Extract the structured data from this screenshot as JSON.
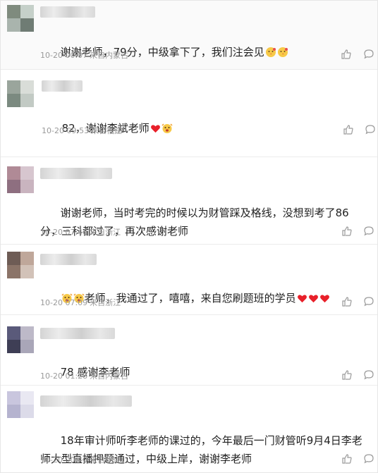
{
  "comments": [
    {
      "text": "谢谢老师，79分，中级拿下了，我们注会见",
      "time": "10-20 00:07",
      "location": "来自内蒙古",
      "trailing_emojis": [
        "kiss-face",
        "kiss-face"
      ],
      "avatar_colors": [
        "#7f8b7e",
        "#c5d0c9",
        "#a9b4ad",
        "#6f7c74"
      ]
    },
    {
      "text": "82，谢谢李斌老师",
      "time": "10-20 09:53",
      "location": "来自福建",
      "trailing_emojis": [
        "red-heart",
        "cheering-face"
      ],
      "avatar_colors": [
        "#9aa59c",
        "#d9ddd8",
        "#7b8a80",
        "#c2cac4"
      ]
    },
    {
      "text": "谢谢老师，当时考完的时候以为财管踩及格线，没想到考了86分，三科都过了，再次感谢老师",
      "time": "10-20 07:46",
      "location": "来自浙江",
      "trailing_emojis": [],
      "avatar_colors": [
        "#b08a96",
        "#d7c6cf",
        "#8e6f80",
        "#c9b4bf"
      ]
    },
    {
      "text": "老师，我通过了，嘻嘻，来自您刷题班的学员",
      "time": "10-20 07:09",
      "location": "来自浙江",
      "leading_emojis": [
        "cheering-face",
        "cheering-face"
      ],
      "trailing_emojis": [
        "red-heart",
        "red-heart",
        "red-heart"
      ],
      "avatar_colors": [
        "#6e5c55",
        "#bfa79a",
        "#8b7468",
        "#d2c2b8"
      ]
    },
    {
      "text": "78 感谢李老师",
      "time": "10-20 01:28",
      "location": "来自内蒙古",
      "trailing_emojis": [],
      "avatar_colors": [
        "#5a5a7a",
        "#bdb9c8",
        "#3e3e55",
        "#a9a6b8"
      ]
    },
    {
      "text": "18年审计师听李老师的课过的，今年最后一门财管听9月4日李老师大型直播押题通过，中级上岸，谢谢李老师",
      "time": "10-20 00:40",
      "location": "来自北京",
      "trailing_emojis": [],
      "avatar_colors": [
        "#c9c6de",
        "#e9e8f2",
        "#b5b3cf",
        "#dcdbe9"
      ]
    }
  ]
}
